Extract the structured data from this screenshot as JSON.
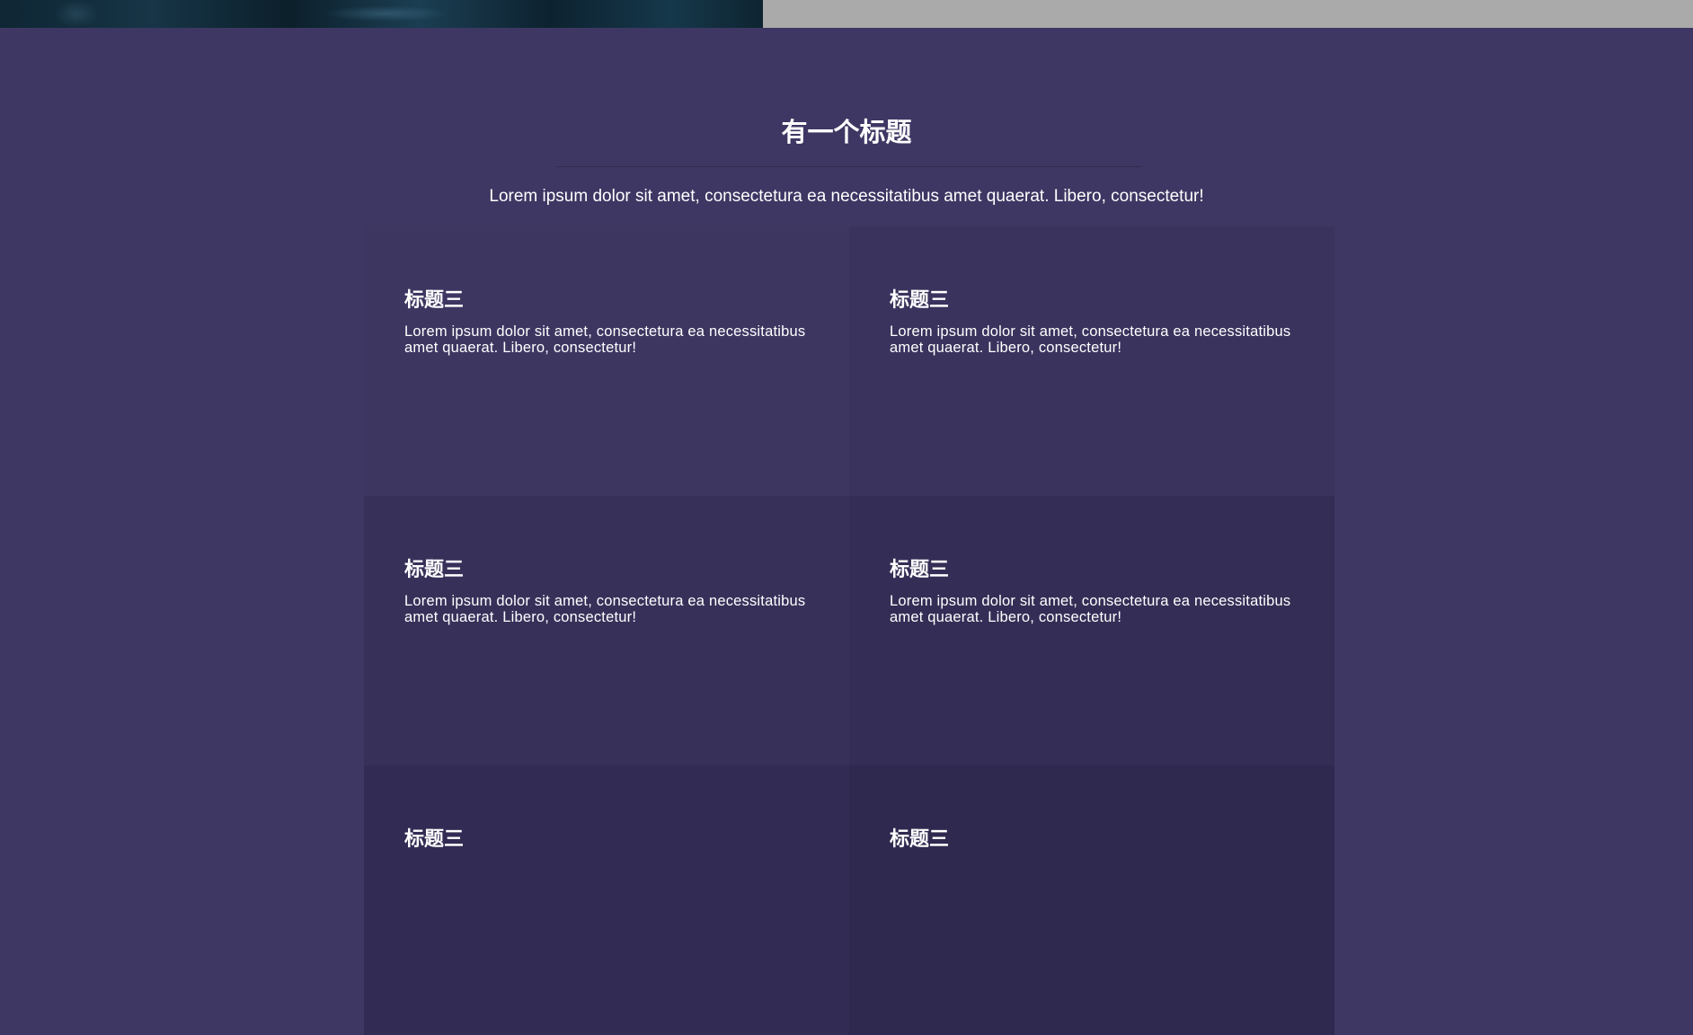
{
  "section": {
    "title": "有一个标题",
    "subtitle": "Lorem ipsum dolor sit amet, consectetura ea necessitatibus amet quaerat. Libero, consectetur!"
  },
  "cards": [
    {
      "title": "标题三",
      "text": "Lorem ipsum dolor sit amet, consectetura ea necessitatibus amet quaerat. Libero, consectetur!"
    },
    {
      "title": "标题三",
      "text": "Lorem ipsum dolor sit amet, consectetura ea necessitatibus amet quaerat. Libero, consectetur!"
    },
    {
      "title": "标题三",
      "text": "Lorem ipsum dolor sit amet, consectetura ea necessitatibus amet quaerat. Libero, consectetur!"
    },
    {
      "title": "标题三",
      "text": "Lorem ipsum dolor sit amet, consectetura ea necessitatibus amet quaerat. Libero, consectetur!"
    },
    {
      "title": "标题三",
      "text": ""
    },
    {
      "title": "标题三",
      "text": ""
    }
  ],
  "colors": {
    "page_background": "#3e3763",
    "top_strip_gray": "#aaaaaa",
    "text": "#ffffff"
  }
}
